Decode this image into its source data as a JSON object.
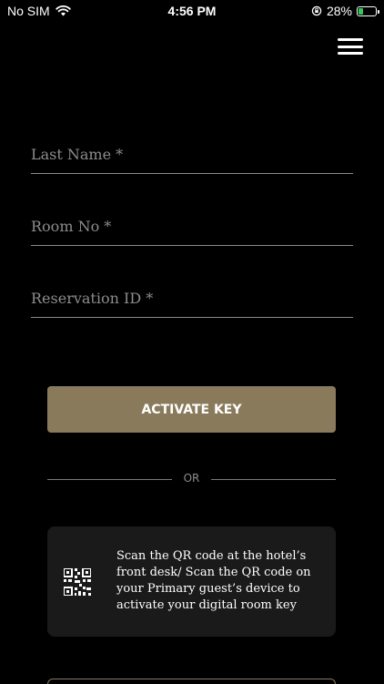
{
  "status_bar": {
    "carrier": "No SIM",
    "time": "4:56 PM",
    "battery_percent_text": "28%",
    "battery_level": 0.28
  },
  "form": {
    "last_name_placeholder": "Last Name *",
    "room_no_placeholder": "Room No *",
    "reservation_id_placeholder": "Reservation ID *"
  },
  "actions": {
    "activate_label": "ACTIVATE KEY",
    "or_label": "OR"
  },
  "qr": {
    "text": "Scan the QR code at the hotel’s front desk/ Scan the QR code on your Primary guest’s device to activate your digital room key"
  },
  "colors": {
    "background": "#000000",
    "accent": "#8a7a5c",
    "card": "#1a1a1a",
    "battery": "#34c759"
  }
}
